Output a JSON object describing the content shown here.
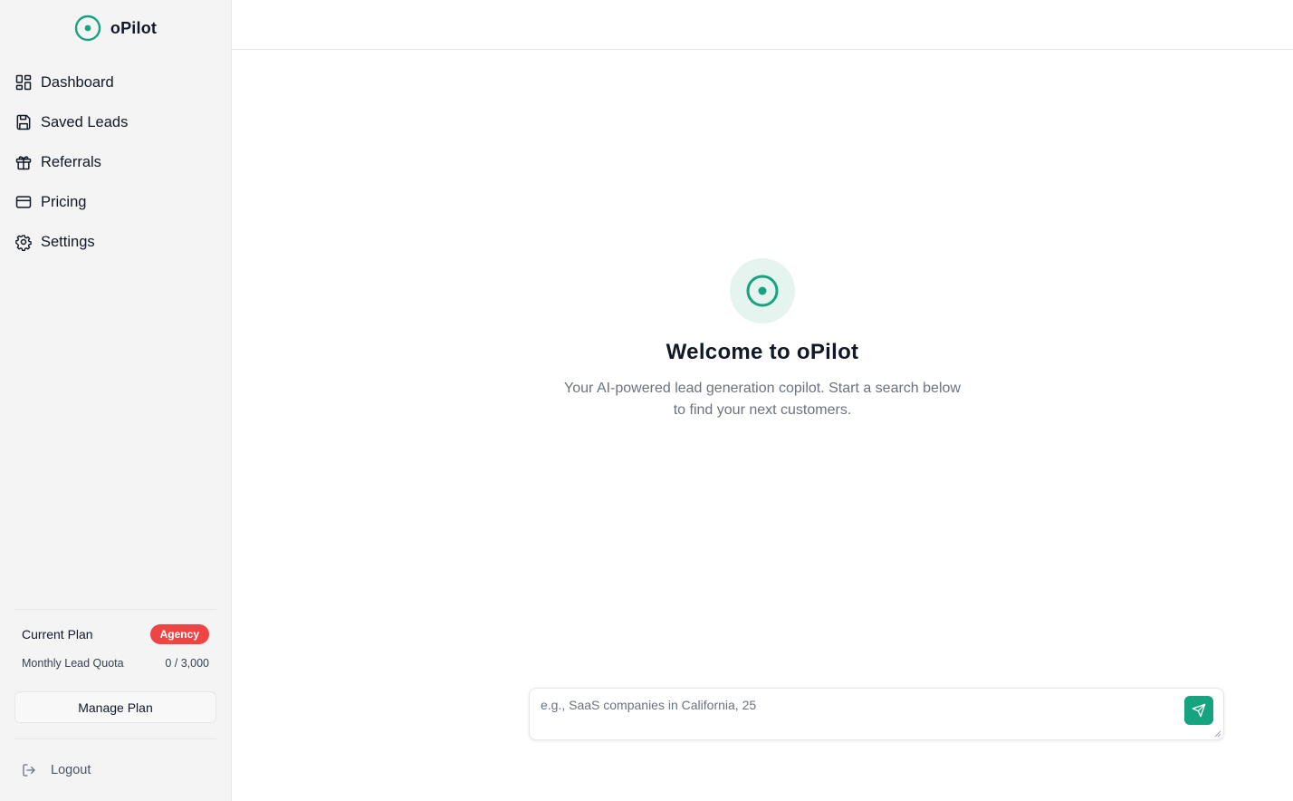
{
  "brand": {
    "name": "oPilot",
    "color": "#16a37f"
  },
  "nav": {
    "items": [
      {
        "label": "Dashboard",
        "icon": "dashboard-grid-icon"
      },
      {
        "label": "Saved Leads",
        "icon": "save-icon"
      },
      {
        "label": "Referrals",
        "icon": "gift-icon"
      },
      {
        "label": "Pricing",
        "icon": "credit-card-icon"
      },
      {
        "label": "Settings",
        "icon": "gear-icon"
      }
    ]
  },
  "plan": {
    "title": "Current Plan",
    "badge": "Agency",
    "badge_color": "#ef4444",
    "quota_label": "Monthly Lead Quota",
    "quota_value": "0 / 3,000",
    "manage_label": "Manage Plan"
  },
  "logout": {
    "label": "Logout",
    "icon": "logout-icon"
  },
  "welcome": {
    "title": "Welcome to oPilot",
    "subtitle": "Your AI-powered lead generation copilot. Start a search below to find your next customers.",
    "icon": "target-icon"
  },
  "composer": {
    "placeholder": "e.g., SaaS companies in California, 25",
    "value": "",
    "send_icon": "send-icon"
  }
}
